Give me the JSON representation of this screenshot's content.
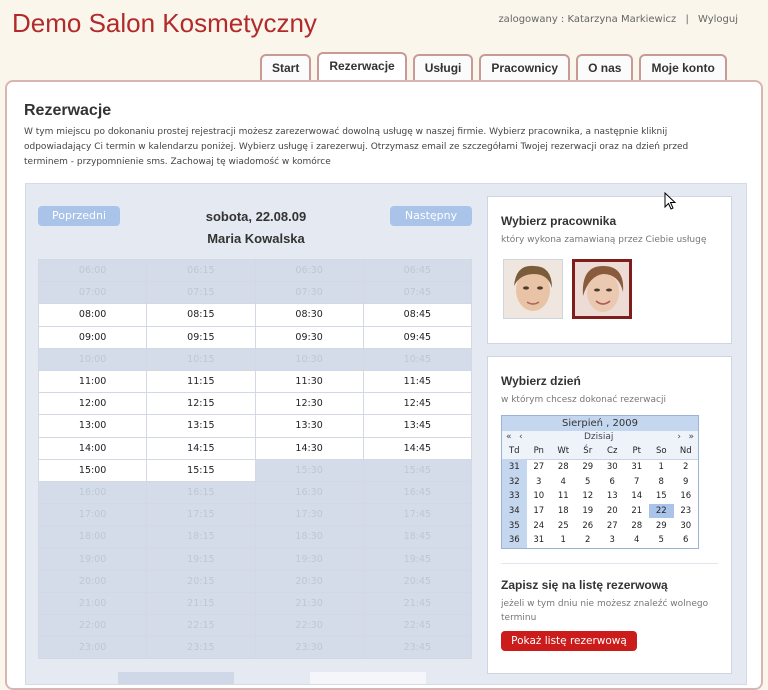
{
  "brand": "Demo Salon Kosmetyczny",
  "user": {
    "text": "zalogowany : Katarzyna Markiewicz",
    "sep": "|",
    "logout": "Wyloguj"
  },
  "tabs": [
    "Start",
    "Rezerwacje",
    "Usługi",
    "Pracownicy",
    "O nas",
    "Moje konto"
  ],
  "active_tab": "Rezerwacje",
  "page": {
    "title": "Rezerwacje",
    "intro": "W tym miejscu po dokonaniu prostej rejestracji możesz zarezerwować dowolną usługę w naszej firmie. Wybierz pracownika, a następnie kliknij odpowiadający Ci termin w kalendarzu poniżej. Wybierz usługę i zarezerwuj. Otrzymasz email ze szczegółami Twojej rezerwacji oraz na dzień przed terminem - przypomnienie sms. Zachowaj tę wiadomość w komórce"
  },
  "schedule": {
    "prev": "Poprzedni",
    "next": "Następny",
    "date": "sobota, 22.08.09",
    "employee": "Maria Kowalska",
    "rows": [
      {
        "times": [
          "06:00",
          "06:15",
          "06:30",
          "06:45"
        ],
        "state": [
          "d",
          "d",
          "d",
          "d"
        ]
      },
      {
        "times": [
          "07:00",
          "07:15",
          "07:30",
          "07:45"
        ],
        "state": [
          "d",
          "d",
          "d",
          "d"
        ]
      },
      {
        "times": [
          "08:00",
          "08:15",
          "08:30",
          "08:45"
        ],
        "state": [
          "a",
          "a",
          "a",
          "a"
        ]
      },
      {
        "times": [
          "09:00",
          "09:15",
          "09:30",
          "09:45"
        ],
        "state": [
          "a",
          "a",
          "a",
          "a"
        ]
      },
      {
        "times": [
          "10:00",
          "10:15",
          "10:30",
          "10:45"
        ],
        "state": [
          "d",
          "d",
          "d",
          "d"
        ]
      },
      {
        "times": [
          "11:00",
          "11:15",
          "11:30",
          "11:45"
        ],
        "state": [
          "a",
          "a",
          "a",
          "a"
        ]
      },
      {
        "times": [
          "12:00",
          "12:15",
          "12:30",
          "12:45"
        ],
        "state": [
          "a",
          "a",
          "a",
          "a"
        ]
      },
      {
        "times": [
          "13:00",
          "13:15",
          "13:30",
          "13:45"
        ],
        "state": [
          "a",
          "a",
          "a",
          "a"
        ]
      },
      {
        "times": [
          "14:00",
          "14:15",
          "14:30",
          "14:45"
        ],
        "state": [
          "a",
          "a",
          "a",
          "a"
        ]
      },
      {
        "times": [
          "15:00",
          "15:15",
          "15:30",
          "15:45"
        ],
        "state": [
          "a",
          "a",
          "d",
          "d"
        ]
      },
      {
        "times": [
          "16:00",
          "16:15",
          "16:30",
          "16:45"
        ],
        "state": [
          "d",
          "d",
          "d",
          "d"
        ]
      },
      {
        "times": [
          "17:00",
          "17:15",
          "17:30",
          "17:45"
        ],
        "state": [
          "d",
          "d",
          "d",
          "d"
        ]
      },
      {
        "times": [
          "18:00",
          "18:15",
          "18:30",
          "18:45"
        ],
        "state": [
          "d",
          "d",
          "d",
          "d"
        ]
      },
      {
        "times": [
          "19:00",
          "19:15",
          "19:30",
          "19:45"
        ],
        "state": [
          "d",
          "d",
          "d",
          "d"
        ]
      },
      {
        "times": [
          "20:00",
          "20:15",
          "20:30",
          "20:45"
        ],
        "state": [
          "d",
          "d",
          "d",
          "d"
        ]
      },
      {
        "times": [
          "21:00",
          "21:15",
          "21:30",
          "21:45"
        ],
        "state": [
          "d",
          "d",
          "d",
          "d"
        ]
      },
      {
        "times": [
          "22:00",
          "22:15",
          "22:30",
          "22:45"
        ],
        "state": [
          "d",
          "d",
          "d",
          "d"
        ]
      },
      {
        "times": [
          "23:00",
          "23:15",
          "23:30",
          "23:45"
        ],
        "state": [
          "d",
          "d",
          "d",
          "d"
        ]
      }
    ]
  },
  "employees": {
    "title": "Wybierz pracownika",
    "subtitle": "który wykona zamawianą przez Ciebie usługę"
  },
  "day": {
    "title": "Wybierz dzień",
    "subtitle": "w którym chcesz dokonać rezerwacji",
    "calendar": {
      "month": "Sierpień , 2009",
      "today": "Dzisiaj",
      "prev_year": "«",
      "prev_month": "‹",
      "next_month": "›",
      "next_year": "»",
      "headers": [
        "Td",
        "Pn",
        "Wt",
        "Śr",
        "Cz",
        "Pt",
        "So",
        "Nd"
      ],
      "weeks": [
        {
          "wk": "31",
          "days": [
            "27",
            "28",
            "29",
            "30",
            "31",
            "1",
            "2"
          ]
        },
        {
          "wk": "32",
          "days": [
            "3",
            "4",
            "5",
            "6",
            "7",
            "8",
            "9"
          ]
        },
        {
          "wk": "33",
          "days": [
            "10",
            "11",
            "12",
            "13",
            "14",
            "15",
            "16"
          ]
        },
        {
          "wk": "34",
          "days": [
            "17",
            "18",
            "19",
            "20",
            "21",
            "22",
            "23"
          ]
        },
        {
          "wk": "35",
          "days": [
            "24",
            "25",
            "26",
            "27",
            "28",
            "29",
            "30"
          ]
        },
        {
          "wk": "36",
          "days": [
            "31",
            "1",
            "2",
            "3",
            "4",
            "5",
            "6"
          ]
        }
      ],
      "selected": "22"
    }
  },
  "waitlist": {
    "title": "Zapisz się na listę rezerwową",
    "subtitle": "jeżeli w tym dniu nie możesz znaleźć wolnego terminu",
    "button": "Pokaż listę rezerwową"
  },
  "colors": {
    "brand": "#b22a2a",
    "accent_button": "#cc1b1b",
    "nav_button": "#a9c4e8",
    "sunday": "#c21818"
  }
}
